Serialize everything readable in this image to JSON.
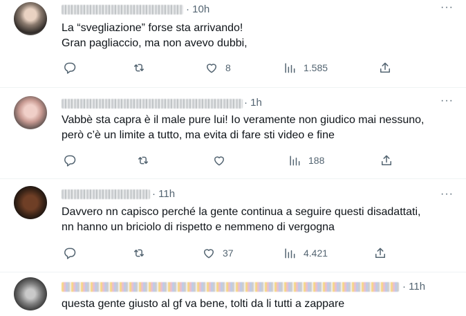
{
  "tweets": [
    {
      "time": "· 10h",
      "text": "La “svegliazione” forse sta arrivando!\nGran pagliaccio, ma non avevo dubbi,",
      "replies": "",
      "retweets": "",
      "likes": "8",
      "views": "1.585"
    },
    {
      "time": "· 1h",
      "text": "Vabbè sta capra è il male pure lui! Io veramente non giudico mai nessuno,\nperò c’è un limite a tutto, ma evita di fare sti video e fine",
      "replies": "",
      "retweets": "",
      "likes": "",
      "views": "188"
    },
    {
      "time": "· 11h",
      "text": "Davvero nn capisco perché la gente continua a seguire questi disadattati,\nnn hanno un briciolo di rispetto e nemmeno di vergogna",
      "replies": "",
      "retweets": "",
      "likes": "37",
      "views": "4.421"
    },
    {
      "time": "· 11h",
      "text": "questa gente giusto al gf va bene, tolti da li tutti a zappare",
      "replies": "",
      "retweets": "",
      "likes": "",
      "views": ""
    }
  ],
  "icons": {
    "reply": "reply-icon",
    "retweet": "retweet-icon",
    "like": "heart-icon",
    "views": "views-icon",
    "share": "share-icon",
    "more": "more-icon"
  },
  "more_glyph": "···",
  "colors": {
    "text": "#0f1419",
    "secondary": "#536471",
    "divider": "#eff3f4"
  }
}
